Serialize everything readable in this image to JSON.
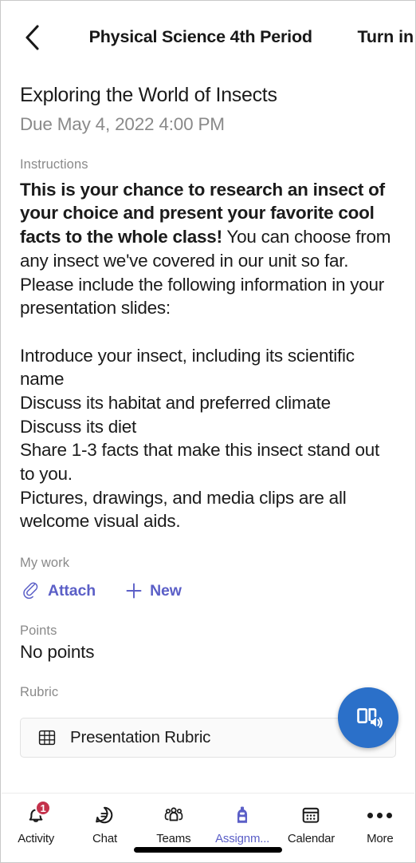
{
  "window": {
    "accent_color": "#5b5fc7",
    "fab_color": "#2b70c9",
    "badge_color": "#c4314b"
  },
  "topbar": {
    "back_icon": "chevron-left-icon",
    "title": "Physical Science 4th Period",
    "turn_in_label": "Turn in"
  },
  "assignment": {
    "title": "Exploring the World of Insects",
    "due": "Due May 4, 2022 4:00 PM",
    "instructions_label": "Instructions",
    "instructions_lead": "This is your chance to research an insect of your choice and present your favorite cool facts to the whole class!",
    "instructions_rest": " You can choose from any insect we've covered in our unit so far. Please include the following information in your presentation slides:\n\nIntroduce your insect, including its scientific name\nDiscuss its habitat and preferred climate\nDiscuss its diet\nShare 1-3 facts that make this insect stand out to you.\nPictures, drawings, and media clips are all welcome visual aids."
  },
  "my_work": {
    "label": "My work",
    "attach_label": "Attach",
    "attach_icon": "paperclip-icon",
    "new_label": "New",
    "new_icon": "plus-icon"
  },
  "points": {
    "label": "Points",
    "value": "No points"
  },
  "rubric": {
    "label": "Rubric",
    "icon": "grid-table-icon",
    "name": "Presentation Rubric"
  },
  "fab": {
    "icon": "immersive-reader-icon"
  },
  "bottom_nav": {
    "items": [
      {
        "label": "Activity",
        "icon": "bell-icon",
        "badge": "1",
        "active": false
      },
      {
        "label": "Chat",
        "icon": "chat-bubble-icon",
        "badge": "",
        "active": false
      },
      {
        "label": "Teams",
        "icon": "people-icon",
        "badge": "",
        "active": false
      },
      {
        "label": "Assignm...",
        "icon": "backpack-icon",
        "badge": "",
        "active": true
      },
      {
        "label": "Calendar",
        "icon": "calendar-icon",
        "badge": "",
        "active": false
      },
      {
        "label": "More",
        "icon": "ellipsis-icon",
        "badge": "",
        "active": false
      }
    ]
  }
}
